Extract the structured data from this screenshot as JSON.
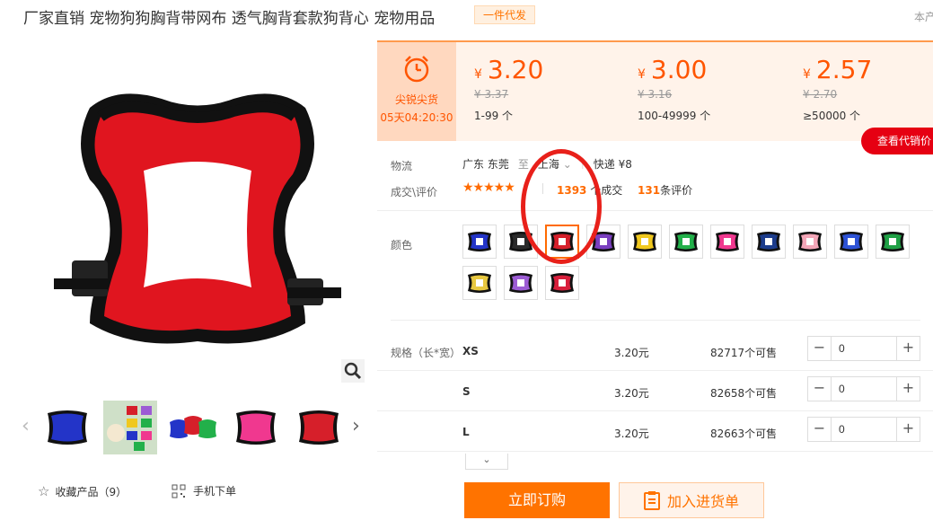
{
  "title": "厂家直销 宠物狗狗胸背带网布 透气胸背套款狗背心 宠物用品",
  "title_badge": "一件代发",
  "top_right_text": "本产",
  "gallery": {
    "favorites_label": "收藏产品（9）",
    "mobile_order_label": "手机下单"
  },
  "flash_sale": {
    "title": "尖锐尖货",
    "countdown": "05天04:20:30"
  },
  "price_tiers": [
    {
      "currency": "¥",
      "price": "3.20",
      "old_price": "¥ 3.37",
      "range": "1-99 个"
    },
    {
      "currency": "¥",
      "price": "3.00",
      "old_price": "¥ 3.16",
      "range": "100-49999 个"
    },
    {
      "currency": "¥",
      "price": "2.57",
      "old_price": "¥ 2.70",
      "range": "≥50000 个"
    }
  ],
  "agent_price_button": "查看代销价",
  "logistics": {
    "label": "物流",
    "origin": "广东 东莞",
    "to": "至",
    "destination": "上海",
    "express": "快递 ¥8"
  },
  "deals": {
    "label": "成交\\评价",
    "rating_stars": 5,
    "deal_count": "1393",
    "deal_suffix": "个成交",
    "review_count": "131",
    "review_suffix": "条评价"
  },
  "color_label": "颜色",
  "swatches": [
    {
      "color": "#2334c8"
    },
    {
      "color": "#2a2a2a"
    },
    {
      "color": "#d61f2a",
      "selected": true
    },
    {
      "color": "#7a3fc0"
    },
    {
      "color": "#f0c81e"
    },
    {
      "color": "#22b04a"
    },
    {
      "color": "#f0388f"
    },
    {
      "color": "#1c3c8c"
    },
    {
      "color": "#f4a6b8"
    },
    {
      "color": "#2d52d6"
    },
    {
      "color": "#1fa045"
    },
    {
      "color": "#e8c840"
    },
    {
      "color": "#9c5cd4"
    },
    {
      "color": "#d81f3c"
    }
  ],
  "spec": {
    "label": "规格（长*宽）",
    "rows": [
      {
        "size": "XS",
        "price": "3.20元",
        "stock": "82717个可售",
        "qty": "0"
      },
      {
        "size": "S",
        "price": "3.20元",
        "stock": "82658个可售",
        "qty": "0"
      },
      {
        "size": "L",
        "price": "3.20元",
        "stock": "82663个可售",
        "qty": "0"
      }
    ]
  },
  "actions": {
    "buy_now": "立即订购",
    "add_to_list": "加入进货单"
  },
  "colors": {
    "accent": "#ff7300",
    "price": "#ff5500",
    "annotation": "#e8201a",
    "agent_button": "#e60012"
  }
}
